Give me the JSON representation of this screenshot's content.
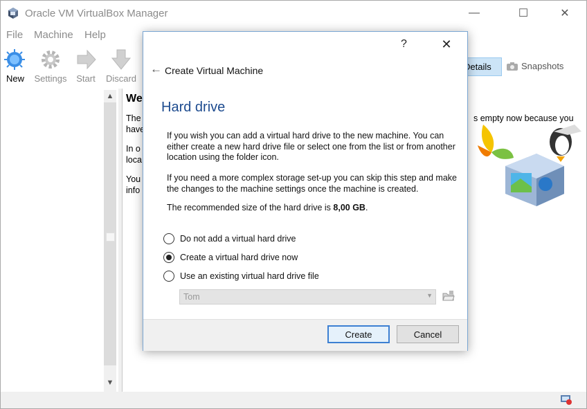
{
  "window": {
    "title": "Oracle VM VirtualBox Manager",
    "minimize_glyph": "—",
    "maximize_glyph": "☐",
    "close_glyph": "✕"
  },
  "menu": [
    "File",
    "Machine",
    "Help"
  ],
  "toolbar": {
    "new": "New",
    "settings": "Settings",
    "start": "Start",
    "discard": "Discard",
    "details": "Details",
    "snapshots": "Snapshots"
  },
  "welcome": {
    "heading": "We",
    "lines_1": [
      "The",
      "have"
    ],
    "lines_2": [
      "In o",
      "loca"
    ],
    "lines_3": [
      "You",
      "info"
    ],
    "right_text": "s empty now because you"
  },
  "dialog": {
    "help_glyph": "?",
    "close_glyph": "✕",
    "back_glyph": "←",
    "title": "Create Virtual Machine",
    "heading": "Hard drive",
    "para1": "If you wish you can add a virtual hard drive to the new machine. You can either create a new hard drive file or select one from the list or from another location using the folder icon.",
    "para2": "If you need a more complex storage set-up you can skip this step and make the changes to the machine settings once the machine is created.",
    "para3_prefix": "The recommended size of the hard drive is ",
    "para3_size": "8,00 GB",
    "para3_suffix": ".",
    "options": [
      {
        "label": "Do not add a virtual hard drive",
        "checked": false
      },
      {
        "label": "Create a virtual hard drive now",
        "checked": true
      },
      {
        "label": "Use an existing virtual hard drive file",
        "checked": false
      }
    ],
    "existing_file_value": "Tom",
    "create_button": "Create",
    "cancel_button": "Cancel"
  },
  "colors": {
    "heading_blue": "#1d4b8f",
    "default_button_border": "#3c7fd2",
    "new_icon": "#3a8ee6"
  },
  "icons": [
    "virtualbox-app-icon",
    "new-icon",
    "settings-icon",
    "start-icon",
    "discard-icon",
    "details-icon",
    "snapshots-icon",
    "folder-icon"
  ]
}
